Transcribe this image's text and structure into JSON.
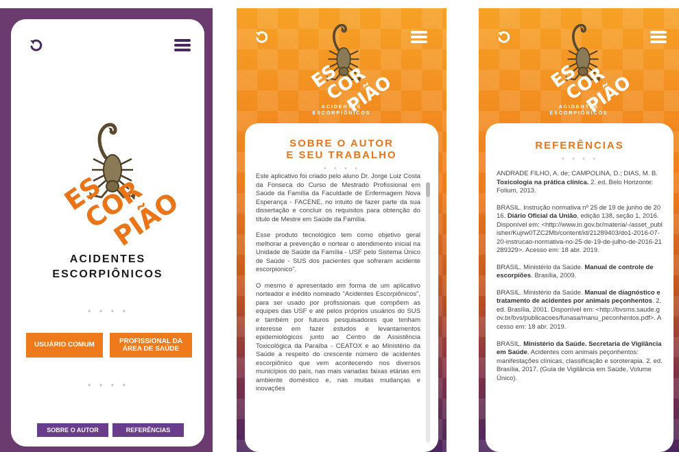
{
  "app": {
    "logo": {
      "line1": "ES",
      "line2": "COR",
      "line3": "PIÃO"
    },
    "subtitle_line1": "ACIDENTES",
    "subtitle_line2": "ESCORPIÔNICOS",
    "icons": {
      "back": "undo-arrow-icon",
      "menu": "hamburger-menu-icon",
      "mascot": "scorpion-icon"
    },
    "colors": {
      "orange": "#ee7a1b",
      "purple": "#6a3c8c",
      "dark_purple": "#4a2660",
      "text": "#444444"
    }
  },
  "home": {
    "dots": "• • • •",
    "dots2": "• • • •",
    "btn_common_user": "USUÁRIO COMUM",
    "btn_health_pro": "PROFISSIONAL DA ÁREA DE SAÚDE",
    "btn_about": "SOBRE O AUTOR",
    "btn_refs": "REFERÊNCIAS"
  },
  "about": {
    "title_line1": "SOBRE O AUTOR",
    "title_line2": "E SEU TRABALHO",
    "dots": "• • • •",
    "paragraphs": [
      "Este aplicativo foi criado pelo aluno Dr. Jorge Luiz Costa da Fonseca do Curso de Mestrado Profissional em Saúde da Família da Faculdade de Enfermagem Nova Esperança - FACENE, no intuito de fazer parte da sua dissertação e concluir os requisitos para obtenção do título de Mestre em Saúde da Família.",
      "Esse produto tecnológico tem como objetivo geral melhorar a prevenção e nortear o atendimento inicial na Unidade de Saúde da Família - USF pelo Sistema Único de Saúde - SUS dos pacientes que sofreram acidente escorpionico\".",
      "O mesmo é apresentado em forma de um aplicativo norteador e inédito nomeado \"Acidentes Escorpiônicos\", para ser usado por profissionais que compõem as equipes das USF e até pelos próprios usuários do SUS e também por futuros pesquisadores que tenham interesse em fazer estudos e levantamentos epidemiológicos junto ao Centro de Assistência Toxicológica da Paraíba - CEATOX e ao Ministério da Saúde a respeito do crescente número de acidentes escorpiônico que vem acontecendo nos diversos municípios do país, nas mais variadas faixas etárias em ambiente doméstico e, nas muitas mudanças e inovações"
    ]
  },
  "refs": {
    "title": "REFERÊNCIAS",
    "dots": "• • • •",
    "items": [
      {
        "pre": "ANDRADE FILHO, A. de; CAMPOLINA, D.; DIAS, M. B. ",
        "bold": "Toxicologia na prática clínica.",
        "post": " 2. ed. Belo Horizonte: Folium, 2013."
      },
      {
        "pre": "BRASIL. Instrução normativa nº 25 de 19 de junho de 2016. ",
        "bold": "Diário Oficial da União",
        "post": ", edição 138, seção 1, 2016. Disponível em: <http://www.in.gov.br/materia/-/asset_publisher/Kujrw0TZC2Mb/content/id/21289403/do1-2016-07-20-instrucao-normativa-no-25-de-19-de-julho-de-2016-21289329>. Acesso em: 18 abr. 2019."
      },
      {
        "pre": "BRASIL. Ministério da Saúde. ",
        "bold": "Manual de controle de escorpiões",
        "post": ". Brasília, 2009."
      },
      {
        "pre": "BRASIL. Ministério da Saúde. ",
        "bold": "Manual de diagnóstico e tratamento de acidentes por animais peçonhentos",
        "post": ". 2. ed. Brasília, 2001. Disponível em: <http://bvsms.saude.gov.br/bvs/publicacoes/funasa/manu_peconhentos.pdf>. Acesso em: 18 abr. 2019."
      },
      {
        "pre": "BRASIL. ",
        "bold": "Ministério da Saúde. Secretaria de Vigilância em Saúde",
        "post": ". Acidentes com animais peçonhentos: manifestações clínicas, classificação e soroterapia. 2. ed. Brasília, 2017. (Guia de Vigilância em Saúde, Volume Único)."
      }
    ]
  }
}
